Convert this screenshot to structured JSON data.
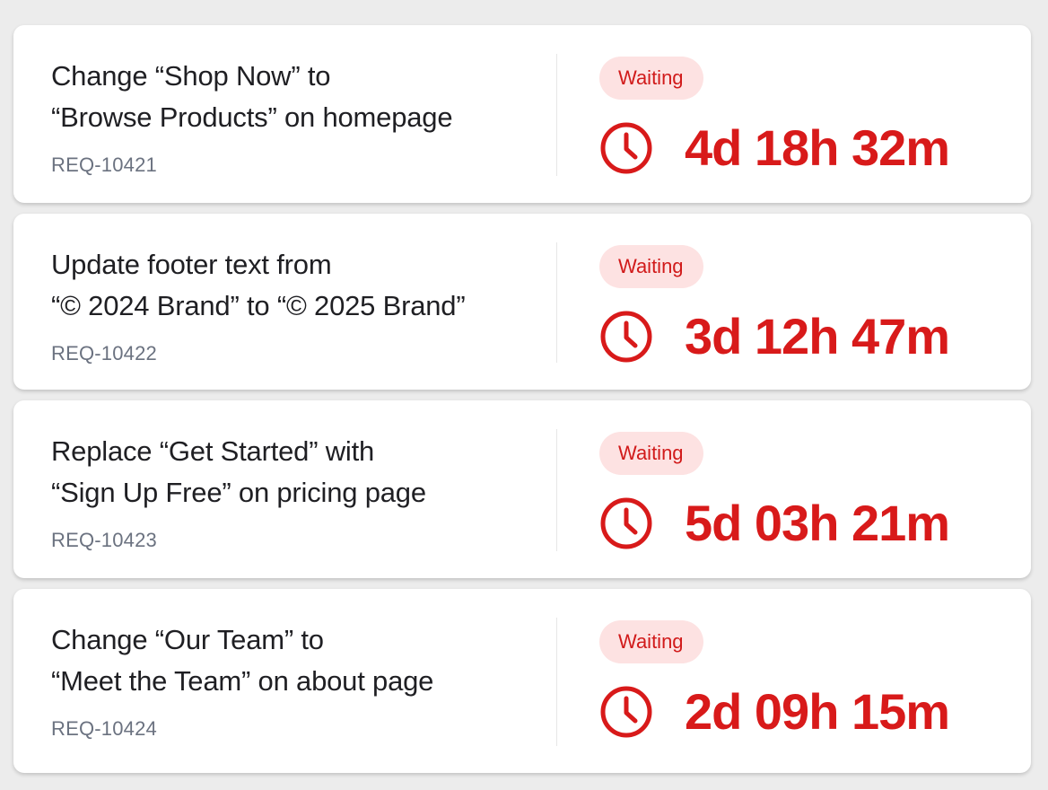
{
  "requests": [
    {
      "title_line1": "Change “Shop Now” to",
      "title_line2": "“Browse Products” on homepage",
      "id": "REQ-10421",
      "status": "Waiting",
      "elapsed": "4d 18h 32m"
    },
    {
      "title_line1": "Update footer text from",
      "title_line2": "“© 2024 Brand” to “© 2025 Brand”",
      "id": "REQ-10422",
      "status": "Waiting",
      "elapsed": "3d 12h 47m"
    },
    {
      "title_line1": "Replace “Get Started” with",
      "title_line2": "“Sign Up Free” on pricing page",
      "id": "REQ-10423",
      "status": "Waiting",
      "elapsed": "5d 03h 21m"
    },
    {
      "title_line1": "Change “Our Team” to",
      "title_line2": "“Meet the Team” on about page",
      "id": "REQ-10424",
      "status": "Waiting",
      "elapsed": "2d 09h 15m"
    }
  ],
  "icons": {
    "timer": "clock-icon"
  },
  "colors": {
    "accent": "#d81a1a",
    "badge_bg": "#fde2e2",
    "id_text": "#6b7280"
  }
}
